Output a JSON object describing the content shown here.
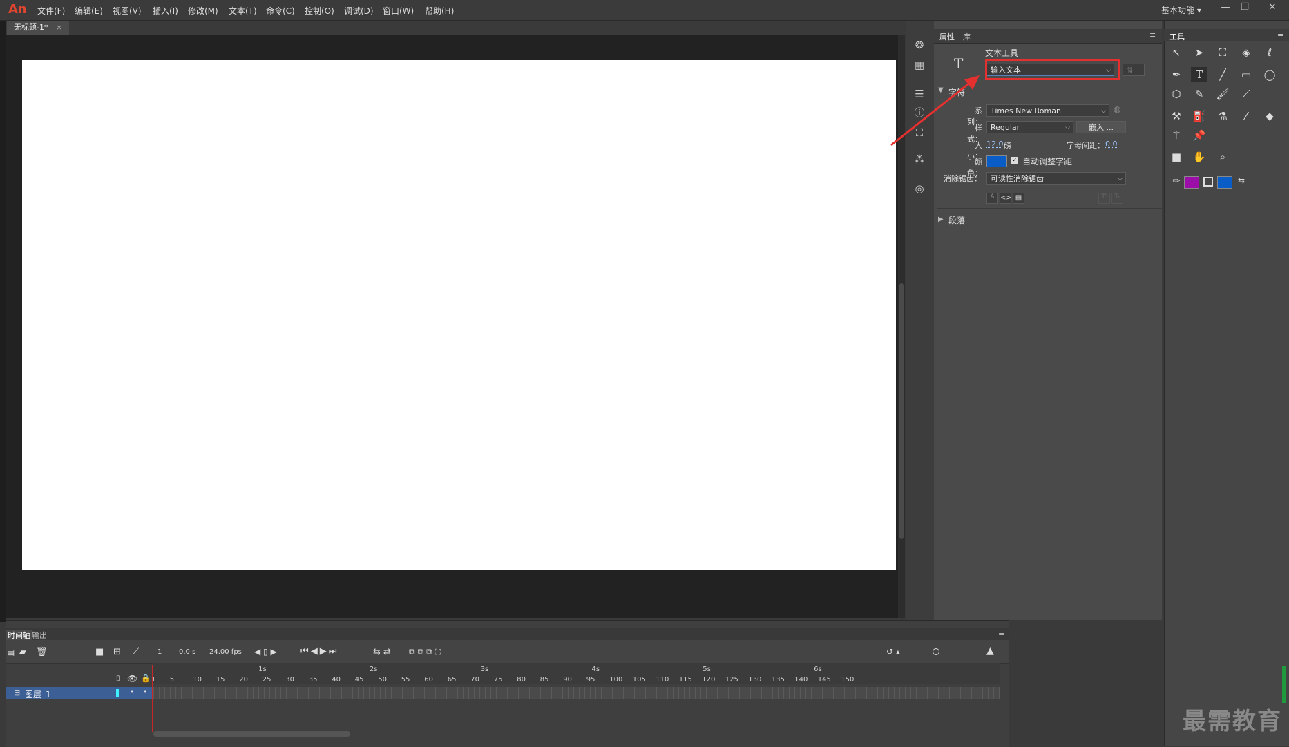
{
  "app": {
    "logo": "An"
  },
  "menu": [
    "文件(F)",
    "编辑(E)",
    "视图(V)",
    "插入(I)",
    "修改(M)",
    "文本(T)",
    "命令(C)",
    "控制(O)",
    "调试(D)",
    "窗口(W)",
    "帮助(H)"
  ],
  "workspace": "基本功能",
  "window_controls": {
    "minimize": "—",
    "restore": "❐",
    "close": "✕"
  },
  "document_tab": {
    "title": "无标题-1*",
    "close": "×"
  },
  "properties": {
    "tabs": [
      "属性",
      "库"
    ],
    "tool_name": "文本工具",
    "text_type": "输入文本",
    "character_section": "字符",
    "family_label": "系列：",
    "family_value": "Times New Roman",
    "style_label": "样式：",
    "style_value": "Regular",
    "embed_button": "嵌入 ...",
    "size_label": "大小：",
    "size_value": "12.0",
    "size_unit": "磅",
    "spacing_label": "字母间距：",
    "spacing_value": "0.0",
    "color_label": "颜色：",
    "text_color": "#0a5cc7",
    "auto_kern_label": "自动调整字距",
    "antialias_label": "消除锯齿：",
    "antialias_value": "可读性消除锯齿",
    "paragraph_section": "段落"
  },
  "tools": {
    "title": "工具",
    "stroke_color": "#9b0fa8",
    "fill_color": "#0a5cc7"
  },
  "timeline": {
    "tabs": [
      "时间轴",
      "输出"
    ],
    "frame": "1",
    "time": "0.0 s",
    "fps": "24.00 fps",
    "seconds": [
      "1s",
      "2s",
      "3s",
      "4s",
      "5s",
      "6s"
    ],
    "frames": [
      "1",
      "5",
      "10",
      "15",
      "20",
      "25",
      "30",
      "35",
      "40",
      "45",
      "50",
      "55",
      "60",
      "65",
      "70",
      "75",
      "80",
      "85",
      "90",
      "95",
      "100",
      "105",
      "110",
      "115",
      "120",
      "125",
      "130",
      "135",
      "140",
      "145",
      "150"
    ],
    "layer_name": "图层_1"
  },
  "watermark": "最需教育"
}
